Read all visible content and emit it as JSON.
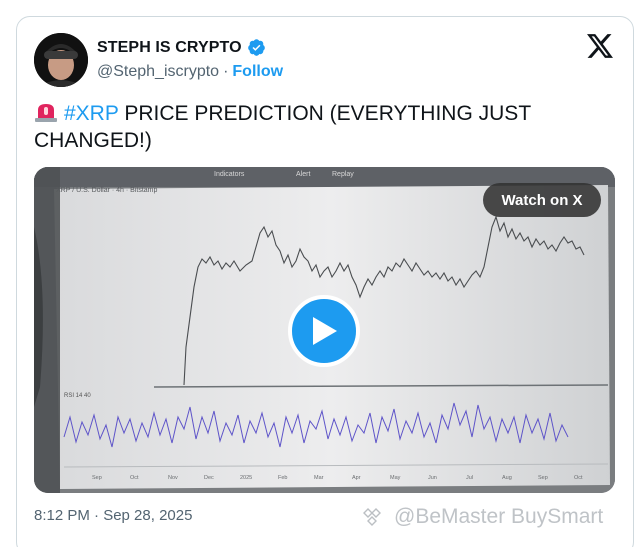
{
  "author": {
    "display_name": "STEPH IS CRYPTO",
    "handle": "@Steph_iscrypto",
    "separator": "·",
    "follow_label": "Follow"
  },
  "tweet": {
    "siren_icon": "police-light-emoji",
    "hashtag": "#XRP",
    "text": " PRICE PREDICTION (EVERYTHING JUST CHANGED!)"
  },
  "media": {
    "watch_label": "Watch on X",
    "screen_header": "XRP / U.S. Dollar · 4h · Bitstamp",
    "toolbar_indicators": "Indicators",
    "toolbar_alert": "Alert",
    "toolbar_replay": "Replay",
    "rsi_label": "RSI 14 40",
    "month_labels": [
      "Sep",
      "Oct",
      "Nov",
      "Dec",
      "2025",
      "Feb",
      "Mar",
      "Apr",
      "May",
      "Jun",
      "Jul",
      "Aug",
      "Sep",
      "Oct"
    ]
  },
  "timestamp": "8:12 PM · Sep 28, 2025",
  "watermark": "@BeMaster BuySmart",
  "colors": {
    "accent": "#1d9bf0",
    "text": "#0f1419",
    "muted": "#536471",
    "border": "#cfd9de"
  }
}
